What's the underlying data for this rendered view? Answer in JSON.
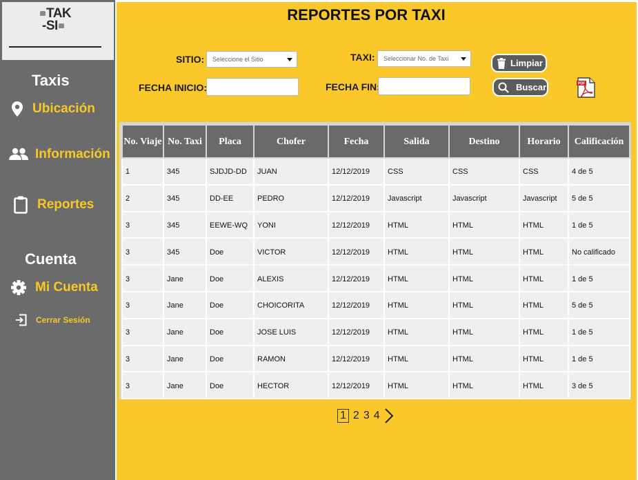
{
  "logo": {
    "line1": "TAK",
    "line2": "-SI"
  },
  "sidebar": {
    "taxis_heading": "Taxis",
    "cuenta_heading": "Cuenta",
    "items": [
      {
        "label": "Ubicación",
        "icon": "location-pin-icon"
      },
      {
        "label": "Información",
        "icon": "people-icon"
      },
      {
        "label": "Reportes",
        "icon": "clipboard-icon"
      },
      {
        "label": "Mi Cuenta",
        "icon": "gear-icon"
      },
      {
        "label": "Cerrar Sesión",
        "icon": "logout-icon"
      }
    ]
  },
  "page_title": "REPORTES POR TAXI",
  "filters": {
    "sitio_label": "SITIO:",
    "sitio_placeholder": "Seleccione el Sitio",
    "taxi_label": "TAXI:",
    "taxi_placeholder": "Seleccionar No. de Taxi",
    "fecha_inicio_label": "FECHA INICIO:",
    "fecha_inicio_value": "",
    "fecha_fin_label": "FECHA FIN:",
    "fecha_fin_value": ""
  },
  "buttons": {
    "limpiar": "Limpiar",
    "buscar": "Buscar",
    "pdf_icon": "pdf-icon"
  },
  "table": {
    "headers": [
      "No. Viaje",
      "No. Taxi",
      "Placa",
      "Chofer",
      "Fecha",
      "Salida",
      "Destino",
      "Horario",
      "Calificación"
    ],
    "rows": [
      [
        "1",
        "345",
        "SJDJD-DD",
        "JUAN",
        "12/12/2019",
        "CSS",
        "CSS",
        "CSS",
        "4 de 5"
      ],
      [
        "2",
        "345",
        "DD-EE",
        "PEDRO",
        "12/12/2019",
        "Javascript",
        "Javascript",
        "Javascript",
        "5 de 5"
      ],
      [
        "3",
        "345",
        "EEWE-WQ",
        "YONI",
        "12/12/2019",
        "HTML",
        "HTML",
        "HTML",
        "1 de 5"
      ],
      [
        "3",
        "345",
        "Doe",
        "VICTOR",
        "12/12/2019",
        "HTML",
        "HTML",
        "HTML",
        "No calificado"
      ],
      [
        "3",
        "Jane",
        "Doe",
        "ALEXIS",
        "12/12/2019",
        "HTML",
        "HTML",
        "HTML",
        "1 de 5"
      ],
      [
        "3",
        "Jane",
        "Doe",
        "CHOICORITA",
        "12/12/2019",
        "HTML",
        "HTML",
        "HTML",
        "5 de 5"
      ],
      [
        "3",
        "Jane",
        "Doe",
        "JOSE LUIS",
        "12/12/2019",
        "HTML",
        "HTML",
        "HTML",
        "1 de 5"
      ],
      [
        "3",
        "Jane",
        "Doe",
        "RAMON",
        "12/12/2019",
        "HTML",
        "HTML",
        "HTML",
        "1 de 5"
      ],
      [
        "3",
        "Jane",
        "Doe",
        "HECTOR",
        "12/12/2019",
        "HTML",
        "HTML",
        "HTML",
        "3 de 5"
      ]
    ]
  },
  "pagination": {
    "pages": [
      "1",
      "2",
      "3",
      "4"
    ],
    "current": "1",
    "next_icon": "chevron-right-icon"
  },
  "colors": {
    "sidebar_bg": "#6b6b6b",
    "main_bg": "#fbc82b",
    "accent": "#f9c825",
    "header_bg": "#6a6a6a"
  }
}
